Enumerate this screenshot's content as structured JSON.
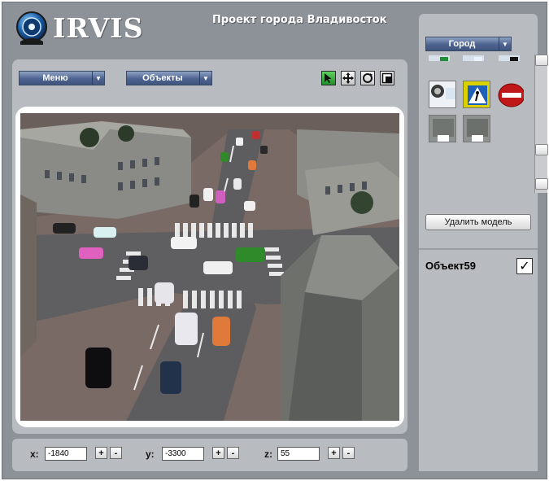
{
  "app": {
    "title": "IRVIS",
    "project_title": "Проект города Владивосток"
  },
  "toolbar": {
    "menu_label": "Меню",
    "objects_label": "Объекты",
    "tools": [
      {
        "name": "select",
        "icon": "cursor-arrow-icon",
        "active": true
      },
      {
        "name": "move",
        "icon": "move-arrows-icon",
        "active": false
      },
      {
        "name": "rotate",
        "icon": "rotate-icon",
        "active": false
      },
      {
        "name": "scale",
        "icon": "scale-box-icon",
        "active": false
      }
    ]
  },
  "coords": {
    "x_label": "x:",
    "x_value": "-1840",
    "y_label": "y:",
    "y_value": "-3300",
    "z_label": "z:",
    "z_value": "55",
    "plus": "+",
    "minus": "-"
  },
  "library": {
    "category_label": "Город",
    "models": [
      {
        "icon": "wheel-model-icon"
      },
      {
        "icon": "pedestrian-crossing-sign-icon"
      },
      {
        "icon": "no-entry-sign-icon"
      },
      {
        "icon": "building-block-icon"
      },
      {
        "icon": "building-block-icon"
      }
    ],
    "delete_label": "Удалить модель"
  },
  "object": {
    "name": "Объект59",
    "checked": true,
    "check_mark": "✓"
  },
  "colors": {
    "panel_bg": "#8d9198",
    "panel_light": "#b8bbbf",
    "dropdown_blue": "#4d6490",
    "active_tool": "#1f8f2a"
  }
}
